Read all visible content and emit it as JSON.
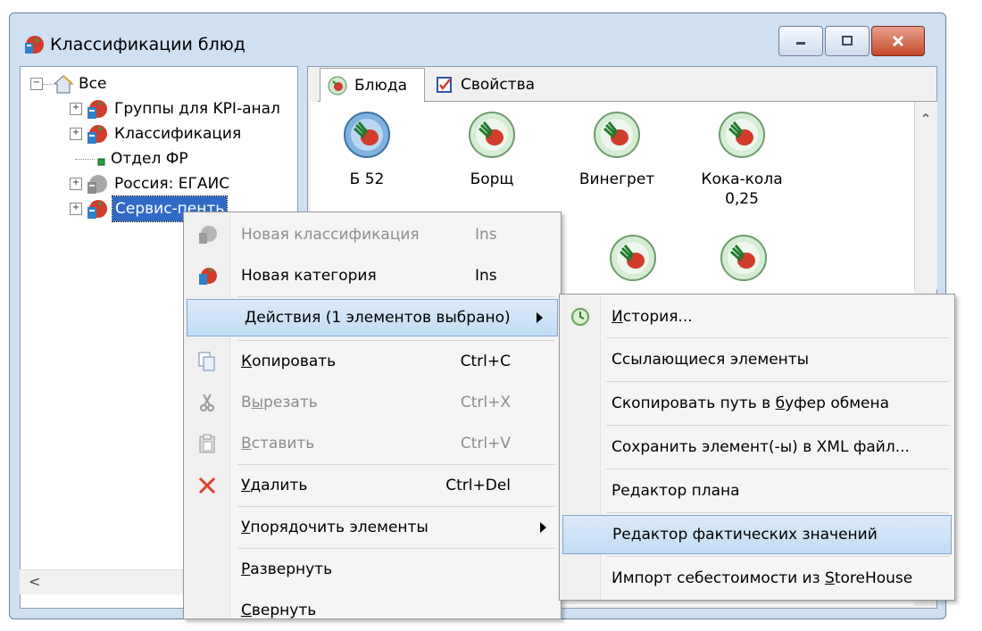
{
  "window": {
    "title": "Классификации блюд",
    "buttons": {
      "minimize": "minimize",
      "maximize": "maximize",
      "close": "close"
    }
  },
  "tree": {
    "root": "Все",
    "items": [
      {
        "label": "Группы для KPI-анал",
        "icon": "classification-icon"
      },
      {
        "label": "Классификация",
        "icon": "classification-icon"
      },
      {
        "label": "Отдел ФР",
        "icon": "green-square-icon"
      },
      {
        "label": "Россия: ЕГАИС",
        "icon": "gray-classification-icon"
      },
      {
        "label": "Сервис-пенть",
        "icon": "classification-icon"
      }
    ]
  },
  "tabs": [
    {
      "label": "Блюда",
      "icon": "dish-icon"
    },
    {
      "label": "Свойства",
      "icon": "properties-icon"
    }
  ],
  "dishes": [
    {
      "line1": "Б 52",
      "line2": ""
    },
    {
      "line1": "Борщ",
      "line2": ""
    },
    {
      "line1": "Винегрет",
      "line2": ""
    },
    {
      "line1": "Кока-кола",
      "line2": "0,25"
    }
  ],
  "context_menu": {
    "items": [
      {
        "label": "Новая классификация",
        "shortcut": "Ins"
      },
      {
        "label": "Новая категория",
        "shortcut": "Ins"
      },
      {
        "label": "Действия (1 элементов выбрано)"
      },
      {
        "ul": "К",
        "rest": "опировать",
        "shortcut": "Ctrl+C"
      },
      {
        "pre": "В",
        "ul": "ы",
        "rest": "резать",
        "shortcut": "Ctrl+X"
      },
      {
        "ul": "В",
        "rest": "ставить",
        "shortcut": "Ctrl+V"
      },
      {
        "ul": "У",
        "rest": "далить",
        "shortcut": "Ctrl+Del"
      },
      {
        "ul": "У",
        "rest": "порядочить элементы"
      },
      {
        "ul": "Р",
        "rest": "азвернуть"
      },
      {
        "ul": "С",
        "rest": "вернуть"
      }
    ]
  },
  "submenu": {
    "items": [
      {
        "ul": "И",
        "rest": "стория..."
      },
      {
        "label": "Ссылающиеся элементы"
      },
      {
        "pre": "Скопировать путь в ",
        "ul": "б",
        "rest": "уфер обмена"
      },
      {
        "label": "Сохранить элемент(-ы) в XML файл..."
      },
      {
        "label": "Редактор плана"
      },
      {
        "label": "Редактор фактических значений"
      },
      {
        "pre": "Импорт себестоимости из ",
        "ul": "S",
        "rest": "toreHouse"
      }
    ]
  },
  "colors": {
    "selection": "#316ac5",
    "menu_highlight": "#c2dcf3",
    "window_frame": "#cfe0f3"
  }
}
